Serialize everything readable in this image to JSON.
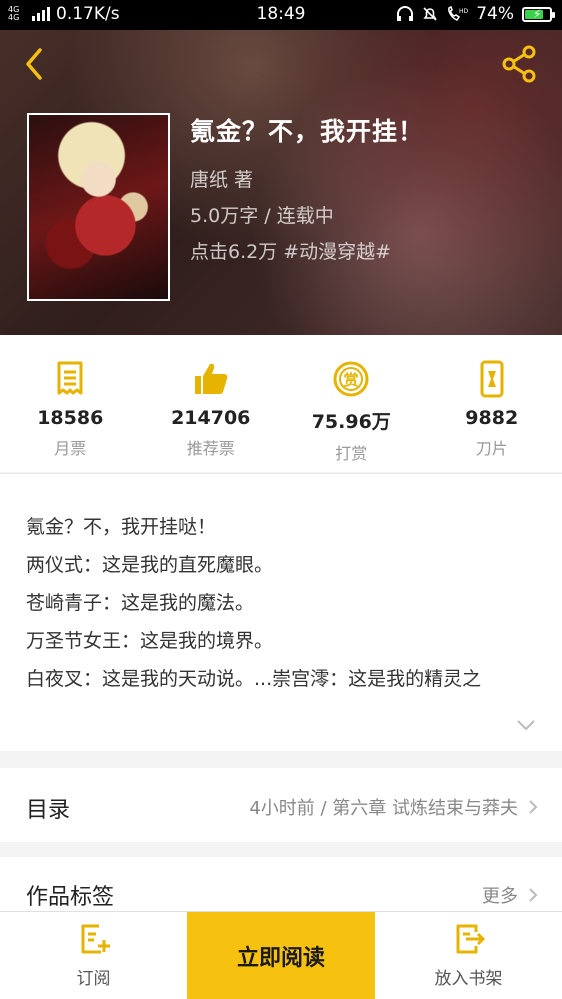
{
  "status_bar": {
    "network": "4G 4G",
    "speed": "0.17K/s",
    "time": "18:49",
    "battery": "74%",
    "battery_level": 0.74
  },
  "book": {
    "title": "氪金？不，我开挂！",
    "author": "唐纸  著",
    "length_status": "5.0万字 / 连载中",
    "clicks_tag": "点击6.2万  #动漫穿越#"
  },
  "stats": [
    {
      "icon": "monthly-ticket-icon",
      "value": "18586",
      "label": "月票"
    },
    {
      "icon": "thumbs-up-icon",
      "value": "214706",
      "label": "推荐票"
    },
    {
      "icon": "reward-coin-icon",
      "value": "75.96万",
      "label": "打赏"
    },
    {
      "icon": "blade-icon",
      "value": "9882",
      "label": "刀片"
    }
  ],
  "intro": {
    "lines": [
      "氪金？不，我开挂哒！",
      "两仪式：这是我的直死魔眼。",
      "苍崎青子：这是我的魔法。",
      "万圣节女王：这是我的境界。",
      "白夜叉：这是我的天动说。...崇宫澪：这是我的精灵之"
    ]
  },
  "catalog": {
    "title": "目录",
    "latest": "4小时前 / 第六章 试炼结束与莽夫"
  },
  "tags": {
    "title": "作品标签",
    "more": "更多"
  },
  "bottom_bar": {
    "subscribe": "订阅",
    "read_now": "立即阅读",
    "add_shelf": "放入书架"
  },
  "colors": {
    "accent": "#f7c110",
    "icon_yellow": "#e6b300"
  }
}
